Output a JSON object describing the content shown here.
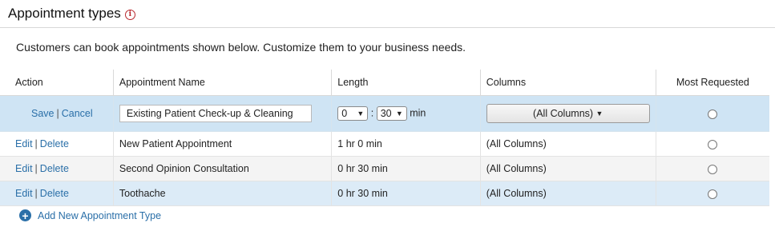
{
  "header": {
    "title": "Appointment types",
    "info_icon": "info-icon"
  },
  "intro": "Customers can book appointments shown below. Customize them to your business needs.",
  "table": {
    "columns": [
      "Action",
      "Appointment Name",
      "Length",
      "Columns",
      "Most Requested"
    ],
    "editing_row": {
      "save_label": "Save",
      "cancel_label": "Cancel",
      "name_value": "Existing Patient Check-up & Cleaning",
      "hours_value": "0",
      "minutes_value": "30",
      "colon": ":",
      "unit": "min",
      "columns_value": "(All Columns)"
    },
    "rows": [
      {
        "edit_label": "Edit",
        "delete_label": "Delete",
        "name": "New Patient Appointment",
        "length": "1 hr 0 min",
        "columns": "(All Columns)"
      },
      {
        "edit_label": "Edit",
        "delete_label": "Delete",
        "name": "Second Opinion Consultation",
        "length": "0 hr 30 min",
        "columns": "(All Columns)"
      },
      {
        "edit_label": "Edit",
        "delete_label": "Delete",
        "name": "Toothache",
        "length": "0 hr 30 min",
        "columns": "(All Columns)"
      }
    ]
  },
  "add_link": "Add New Appointment Type",
  "colors": {
    "link": "#2a6fa8",
    "edit_row_bg": "#cfe4f4",
    "info_icon": "#b8282e"
  }
}
